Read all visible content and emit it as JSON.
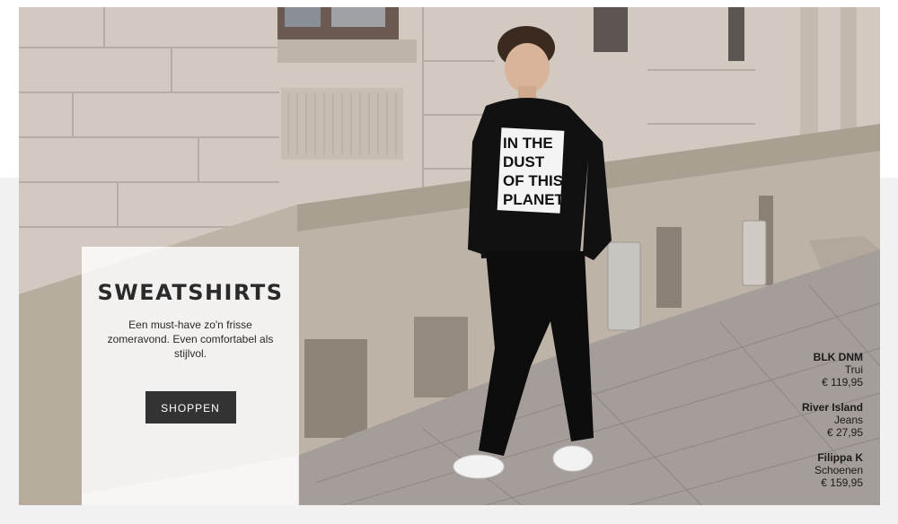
{
  "promo": {
    "title": "SWEATSHIRTS",
    "description": "Een must-have zo'n frisse zomeravond. Even comfortabel als stijlvol.",
    "button_label": "SHOPPEN"
  },
  "model": {
    "shirt_print": [
      "IN THE",
      "DUST",
      "OF THIS",
      "PLANET"
    ]
  },
  "credits": [
    {
      "brand": "BLK DNM",
      "item": "Trui",
      "price": "€ 119,95"
    },
    {
      "brand": "River Island",
      "item": "Jeans",
      "price": "€ 27,95"
    },
    {
      "brand": "Filippa K",
      "item": "Schoenen",
      "price": "€ 159,95"
    }
  ],
  "colors": {
    "background_band": "#f2f1f1",
    "button": "#333333",
    "sweatshirt": "#111111",
    "wall": "#d2cac0",
    "pavement": "#a59d99"
  }
}
